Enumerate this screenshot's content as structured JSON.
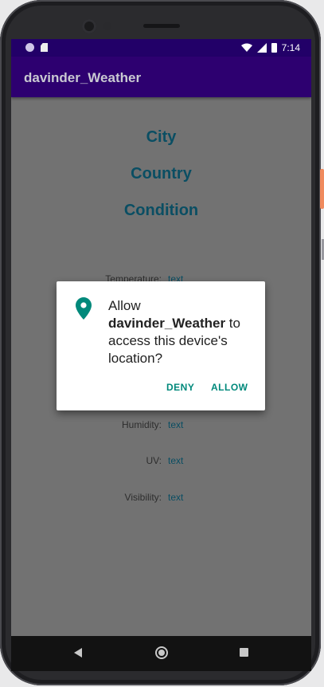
{
  "status_bar": {
    "time": "7:14"
  },
  "app_bar": {
    "title": "davinder_Weather"
  },
  "weather": {
    "city": "City",
    "country": "Country",
    "condition": "Condition",
    "fields": [
      {
        "label": "Temperature:",
        "value": "text"
      },
      {
        "label": "Humidity:",
        "value": "text"
      },
      {
        "label": "UV:",
        "value": "text"
      },
      {
        "label": "Visibility:",
        "value": "text"
      }
    ]
  },
  "permission_dialog": {
    "prefix": "Allow ",
    "app_name": "davinder_Weather",
    "suffix": " to access this device's location?",
    "deny_label": "DENY",
    "allow_label": "ALLOW"
  },
  "colors": {
    "app_bar": "#2d0070",
    "status_bar": "#220068",
    "accent": "#00897b",
    "title_text": "#0a4e63"
  },
  "icons": {
    "status": [
      "notification-dot-icon",
      "sd-card-icon",
      "wifi-icon",
      "signal-icon",
      "battery-icon"
    ],
    "dialog": "location-pin-icon",
    "navigation": [
      "back-icon",
      "home-icon",
      "recents-icon"
    ]
  }
}
